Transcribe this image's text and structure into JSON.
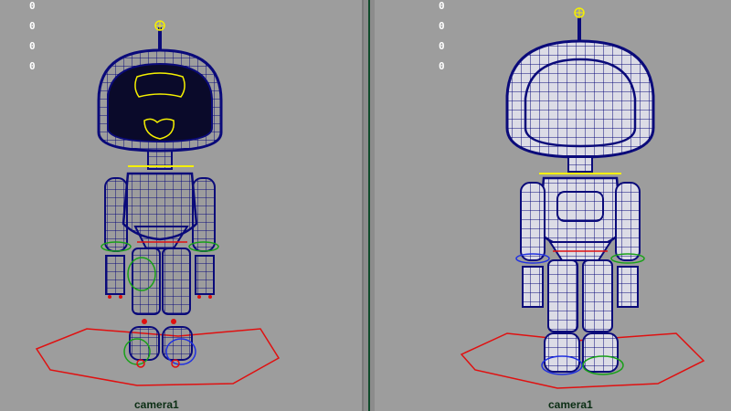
{
  "viewports": {
    "left": {
      "hud_values": [
        "0",
        "0",
        "0",
        "0"
      ],
      "camera_label": "camera1"
    },
    "right": {
      "hud_values": [
        "0",
        "0",
        "0",
        "0"
      ],
      "camera_label": "camera1"
    }
  },
  "colors": {
    "background": "#9d9d9d",
    "wireframe": "#0a0a7a",
    "mesh_fill": "#d9d9e3",
    "controller_red": "#e01010",
    "controller_green": "#18a018",
    "controller_yellow": "#f5f000",
    "controller_blue": "#2030e0",
    "divider": "#0f4a2a"
  }
}
